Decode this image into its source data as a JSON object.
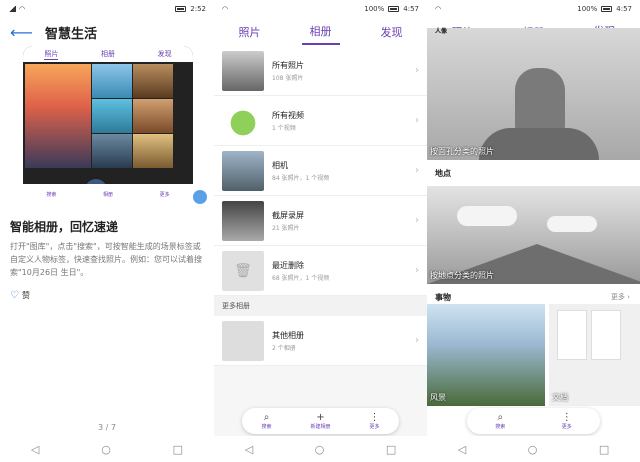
{
  "panel1": {
    "status_time": "2:52",
    "title": "智慧生活",
    "phone_tabs": [
      "照片",
      "相册",
      "发现"
    ],
    "phone_bottom": [
      "搜索",
      "相册",
      "更多"
    ],
    "card_title": "智能相册，回忆速递",
    "card_desc": "打开\"图库\"，点击\"搜索\"，可按智能生成的场景标签或自定义人物标签，快速查找照片。例如：您可以试着搜索\"10月26日 生日\"。",
    "like_label": "赞",
    "page_indicator": "3 / 7"
  },
  "panel2": {
    "status_battery": "100%",
    "status_time": "4:57",
    "tabs": [
      "照片",
      "相册",
      "发现"
    ],
    "albums": [
      {
        "name": "所有照片",
        "count": "108 张照片"
      },
      {
        "name": "所有视频",
        "count": "1 个视频"
      },
      {
        "name": "相机",
        "count": "84 张照片，1 个视频"
      },
      {
        "name": "截屏录屏",
        "count": "21 张照片"
      },
      {
        "name": "最近删除",
        "count": "68 张照片，1 个视频"
      }
    ],
    "more_albums_header": "更多相册",
    "other_album": {
      "name": "其他相册",
      "count": "2 个相册"
    },
    "toolbar": [
      "搜索",
      "新建相册",
      "更多"
    ]
  },
  "panel3": {
    "status_battery": "100%",
    "status_time": "4:57",
    "tabs": [
      "照片",
      "相册",
      "发现"
    ],
    "top_cut_label": "人像",
    "people_overlay": "按面孔分类的照片",
    "places_label": "地点",
    "places_overlay": "按地点分类的照片",
    "things_label": "事物",
    "things_more": "更多",
    "things_items": [
      "风景",
      "文档"
    ],
    "toolbar": [
      "搜索",
      "更多"
    ]
  },
  "colors": {
    "accent": "#6a3fb5",
    "link": "#2a6fd6"
  }
}
